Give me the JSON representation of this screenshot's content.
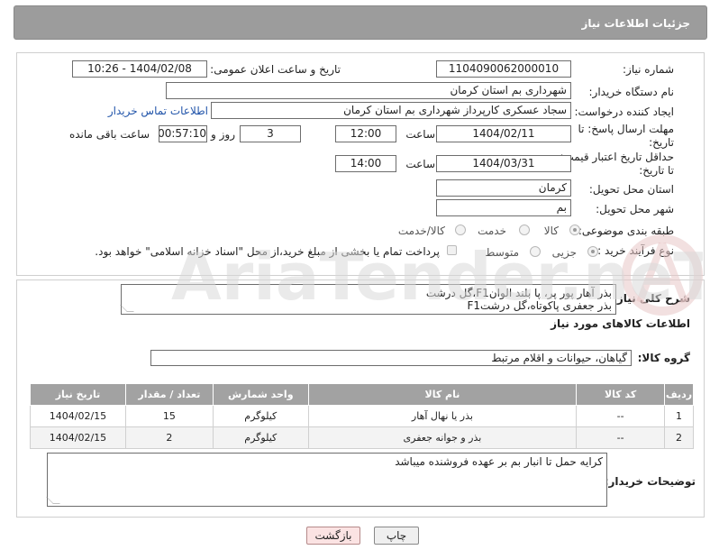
{
  "header": {
    "title": "جزئیات اطلاعات نیاز"
  },
  "form": {
    "need_number_label": "شماره نیاز:",
    "need_number": "1104090062000010",
    "announce_label": "تاریخ و ساعت اعلان عمومی:",
    "announce_value": "1404/02/08 - 10:26",
    "buyer_org_label": "نام دستگاه خریدار:",
    "buyer_org": "شهرداری بم استان کرمان",
    "requester_label": "ایجاد کننده درخواست:",
    "requester": "سجاد عسکری کارپرداز شهرداری بم استان کرمان",
    "contact_link": "اطلاعات تماس خریدار",
    "reply_deadline_label_1": "مهلت ارسال پاسخ: تا",
    "reply_deadline_label_2": "تاریخ:",
    "reply_date": "1404/02/11",
    "time_label": "ساعت",
    "reply_time": "12:00",
    "days_value": "3",
    "days_label": "روز و",
    "remaining_time": "00:57:10",
    "remaining_label": "ساعت باقی مانده",
    "price_validity_label_1": "حداقل تاریخ اعتبار قیمت:",
    "price_validity_label_2": "تا تاریخ:",
    "validity_date": "1404/03/31",
    "validity_time": "14:00",
    "province_label": "استان محل تحویل:",
    "province": "کرمان",
    "city_label": "شهر محل تحویل:",
    "city": "بم",
    "category_label": "طبقه بندی موضوعی:",
    "category_options": [
      "کالا",
      "خدمت",
      "کالا/خدمت"
    ],
    "process_label": "نوع فرآیند خرید :",
    "process_options": [
      "جزیی",
      "متوسط"
    ],
    "payment_note": "پرداخت تمام یا بخشی از مبلغ خرید،از محل \"اسناد خزانه اسلامی\" خواهد بود."
  },
  "description": {
    "label": "شرح کلی نیاز:",
    "line1": "بذر آهار پور پر، پا بلند الوانF1،گل درشت",
    "line2": "بذر جعفری پاکوتاه،گل درشتF1"
  },
  "goods": {
    "section_title": "اطلاعات کالاهای مورد نیاز",
    "group_label": "گروه کالا:",
    "group_value": "گیاهان، حیوانات و اقلام مرتبط",
    "columns": [
      "ردیف",
      "کد کالا",
      "نام کالا",
      "واحد شمارش",
      "تعداد / مقدار",
      "تاریخ نیاز"
    ],
    "rows": [
      [
        "1",
        "--",
        "بذر یا نهال آهار",
        "کیلوگرم",
        "15",
        "1404/02/15"
      ],
      [
        "2",
        "--",
        "بذر و جوانه جعفری",
        "کیلوگرم",
        "2",
        "1404/02/15"
      ]
    ]
  },
  "buyer_notes": {
    "label": "توضیحات خریدار:",
    "text": "کرایه حمل تا انبار بم بر عهده فروشنده میباشد"
  },
  "buttons": {
    "print": "چاپ",
    "back": "بازگشت"
  },
  "watermark": {
    "text": "AriaTender.neT"
  }
}
